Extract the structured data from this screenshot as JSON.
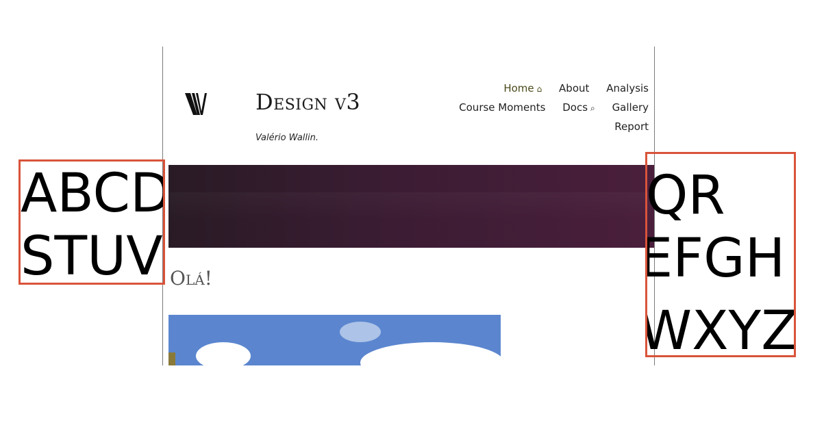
{
  "site": {
    "title": "Design v3",
    "tagline": "Valério Wallin.",
    "logo_letter": "V"
  },
  "nav": {
    "items": [
      {
        "label": "Home",
        "icon": "⌂",
        "active": true
      },
      {
        "label": "About"
      },
      {
        "label": "Analysis"
      },
      {
        "label": "Course Moments"
      },
      {
        "label": "Docs",
        "icon": "⌕"
      },
      {
        "label": "Gallery"
      },
      {
        "label": "Report"
      }
    ]
  },
  "main": {
    "heading": "Olá!"
  },
  "overlays": {
    "left_lines": [
      "ABCD",
      "STUV"
    ],
    "right_lines": [
      "QR",
      "EFGH",
      "WXYZ"
    ]
  },
  "colors": {
    "banner": "#3b1c33",
    "highlight_border": "#d9533a",
    "sky": "#5b86cf"
  }
}
